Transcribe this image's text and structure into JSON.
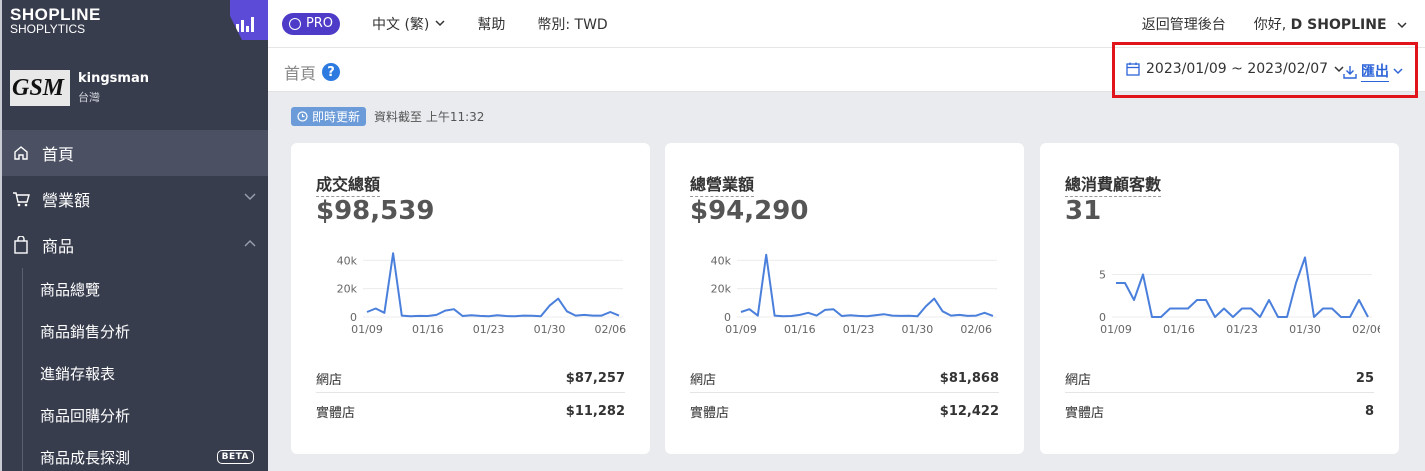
{
  "brand": {
    "name": "SHOPLINE",
    "product": "SHOPLYTICS"
  },
  "store": {
    "logo_text": "GSM",
    "name": "kingsman",
    "region": "台灣"
  },
  "nav": {
    "home": "首頁",
    "sales": "營業額",
    "products": "商品",
    "sub": [
      "商品總覽",
      "商品銷售分析",
      "進銷存報表",
      "商品回購分析",
      "商品成長探測"
    ],
    "beta": "BETA"
  },
  "topbar": {
    "pro": "PRO",
    "language": "中文 (繁)",
    "help": "幫助",
    "currency": "幣別: TWD",
    "back": "返回管理後台",
    "greeting": "你好,",
    "user": "D SHOPLINE"
  },
  "page": {
    "title": "首頁",
    "help_icon": "?",
    "date_range": "2023/01/09 ~ 2023/02/07",
    "export": "匯出"
  },
  "realtime": {
    "badge": "即時更新",
    "note": "資料截至 上午11:32"
  },
  "colors": {
    "line": "#4a7fdc",
    "sidebar": "#383d4e",
    "pro": "#4e3cc8",
    "highlight": "#e0141a"
  },
  "chart_data": [
    {
      "type": "line",
      "title": "成交總額",
      "total": "$98,539",
      "x_ticks": [
        "01/09",
        "01/16",
        "01/23",
        "01/30",
        "02/06"
      ],
      "y_ticks": [
        "0",
        "20k",
        "40k"
      ],
      "ylim": [
        0,
        48000
      ],
      "values": [
        3500,
        6000,
        3000,
        45000,
        1000,
        500,
        800,
        700,
        1500,
        4500,
        5500,
        700,
        1200,
        800,
        500,
        1200,
        700,
        500,
        1000,
        900,
        500,
        8000,
        13000,
        4000,
        1000,
        1500,
        1000,
        1000,
        3500,
        1000
      ],
      "rows": [
        {
          "label": "網店",
          "value": "$87,257"
        },
        {
          "label": "實體店",
          "value": "$11,282"
        }
      ]
    },
    {
      "type": "line",
      "title": "總營業額",
      "total": "$94,290",
      "x_ticks": [
        "01/09",
        "01/16",
        "01/23",
        "01/30",
        "02/06"
      ],
      "y_ticks": [
        "0",
        "20k",
        "40k"
      ],
      "ylim": [
        0,
        48000
      ],
      "values": [
        3500,
        5500,
        1000,
        44000,
        1000,
        500,
        700,
        1500,
        3000,
        1000,
        5000,
        5500,
        700,
        1200,
        800,
        500,
        1200,
        2000,
        1000,
        800,
        900,
        500,
        7500,
        13000,
        4000,
        1000,
        1500,
        800,
        1000,
        3000,
        800
      ],
      "rows": [
        {
          "label": "網店",
          "value": "$81,868"
        },
        {
          "label": "實體店",
          "value": "$12,422"
        }
      ]
    },
    {
      "type": "line",
      "title": "總消費顧客數",
      "total": "31",
      "x_ticks": [
        "01/09",
        "01/16",
        "01/23",
        "01/30",
        "02/06"
      ],
      "y_ticks": [
        "0",
        "5"
      ],
      "ylim": [
        0,
        8
      ],
      "values": [
        4,
        4,
        2,
        5,
        0,
        0,
        1,
        1,
        1,
        2,
        2,
        0,
        1,
        0,
        1,
        1,
        0,
        2,
        0,
        0,
        4,
        7,
        0,
        1,
        1,
        0,
        0,
        2,
        0
      ],
      "rows": [
        {
          "label": "網店",
          "value": "25"
        },
        {
          "label": "實體店",
          "value": "8"
        }
      ]
    }
  ]
}
